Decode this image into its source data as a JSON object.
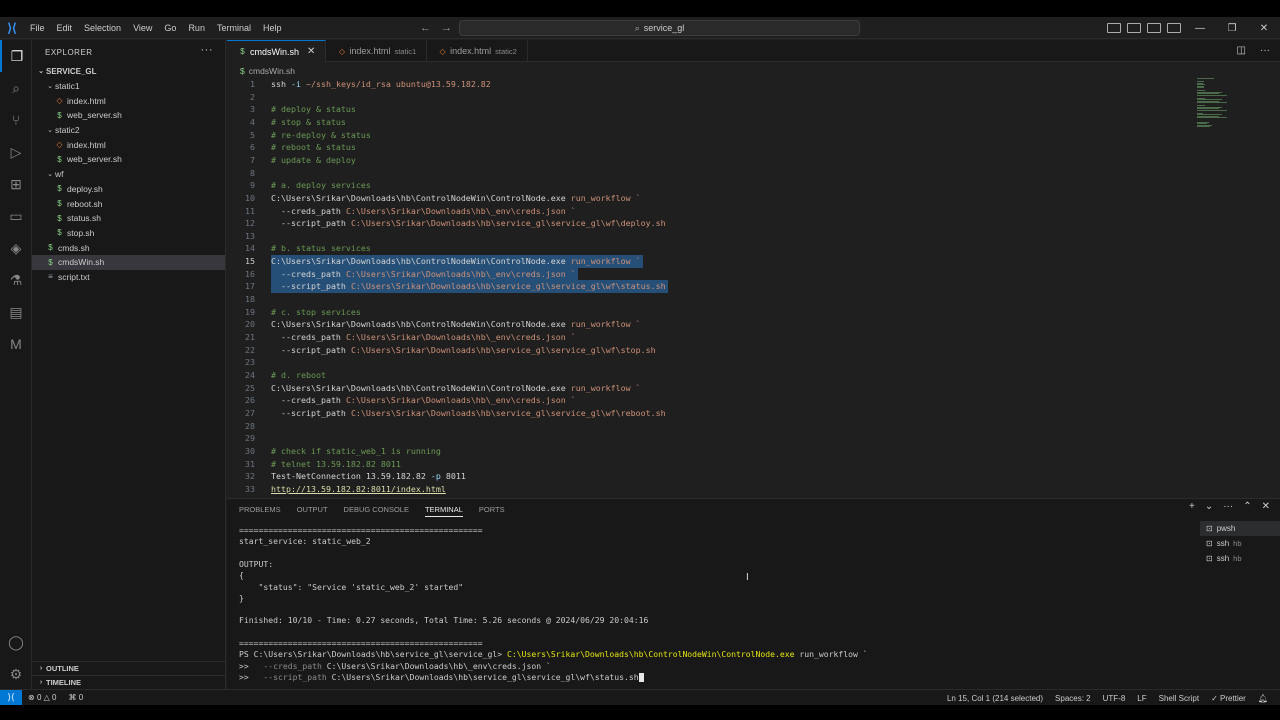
{
  "menu": [
    "File",
    "Edit",
    "Selection",
    "View",
    "Go",
    "Run",
    "Terminal",
    "Help"
  ],
  "command_center": "service_gl",
  "explorer": {
    "header": "EXPLORER",
    "root": "SERVICE_GL",
    "items": [
      {
        "label": "static1",
        "type": "folder",
        "depth": 1
      },
      {
        "label": "index.html",
        "type": "html",
        "depth": 2
      },
      {
        "label": "web_server.sh",
        "type": "sh",
        "depth": 2
      },
      {
        "label": "static2",
        "type": "folder",
        "depth": 1
      },
      {
        "label": "index.html",
        "type": "html",
        "depth": 2
      },
      {
        "label": "web_server.sh",
        "type": "sh",
        "depth": 2
      },
      {
        "label": "wf",
        "type": "folder",
        "depth": 1
      },
      {
        "label": "deploy.sh",
        "type": "sh",
        "depth": 2
      },
      {
        "label": "reboot.sh",
        "type": "sh",
        "depth": 2
      },
      {
        "label": "status.sh",
        "type": "sh",
        "depth": 2
      },
      {
        "label": "stop.sh",
        "type": "sh",
        "depth": 2
      },
      {
        "label": "cmds.sh",
        "type": "sh",
        "depth": 1
      },
      {
        "label": "cmdsWin.sh",
        "type": "sh",
        "depth": 1,
        "selected": true
      },
      {
        "label": "script.txt",
        "type": "txt",
        "depth": 1
      }
    ],
    "outline": "OUTLINE",
    "timeline": "TIMELINE"
  },
  "tabs": [
    {
      "label": "cmdsWin.sh",
      "sub": "",
      "active": true
    },
    {
      "label": "index.html",
      "sub": "static1",
      "active": false
    },
    {
      "label": "index.html",
      "sub": "static2",
      "active": false
    }
  ],
  "breadcrumb": "cmdsWin.sh",
  "code_lines": [
    {
      "n": "1",
      "segs": [
        [
          "",
          "ssh "
        ],
        [
          "flag",
          "-i"
        ],
        [
          "arg",
          " ~/ssh_keys/id_rsa ubuntu@13.59.182.82"
        ]
      ]
    },
    {
      "n": "2",
      "segs": []
    },
    {
      "n": "3",
      "segs": [
        [
          "cmt",
          "# deploy & status"
        ]
      ]
    },
    {
      "n": "4",
      "segs": [
        [
          "cmt",
          "# stop & status"
        ]
      ]
    },
    {
      "n": "5",
      "segs": [
        [
          "cmt",
          "# re-deploy & status"
        ]
      ]
    },
    {
      "n": "6",
      "segs": [
        [
          "cmt",
          "# reboot & status"
        ]
      ]
    },
    {
      "n": "7",
      "segs": [
        [
          "cmt",
          "# update & deploy"
        ]
      ]
    },
    {
      "n": "8",
      "segs": []
    },
    {
      "n": "9",
      "segs": [
        [
          "cmt",
          "# a. deploy services"
        ]
      ]
    },
    {
      "n": "10",
      "segs": [
        [
          "",
          "C:\\Users\\Srikar\\Downloads\\hb\\ControlNodeWin\\ControlNode.exe "
        ],
        [
          "arg",
          "run_workflow `"
        ]
      ]
    },
    {
      "n": "11",
      "segs": [
        [
          "",
          "  --creds_path "
        ],
        [
          "arg",
          "C:\\Users\\Srikar\\Downloads\\hb\\_env\\creds.json `"
        ]
      ]
    },
    {
      "n": "12",
      "segs": [
        [
          "",
          "  --script_path "
        ],
        [
          "arg",
          "C:\\Users\\Srikar\\Downloads\\hb\\service_gl\\service_gl\\wf\\deploy.sh"
        ]
      ]
    },
    {
      "n": "13",
      "segs": []
    },
    {
      "n": "14",
      "segs": [
        [
          "cmt",
          "# b. status services"
        ]
      ]
    },
    {
      "n": "15",
      "segs": [
        [
          "",
          "C:\\Users\\Srikar\\Downloads\\hb\\ControlNodeWin\\ControlNode.exe "
        ],
        [
          "arg",
          "run_workflow `"
        ]
      ],
      "sel": true
    },
    {
      "n": "16",
      "segs": [
        [
          "",
          "  --creds_path "
        ],
        [
          "arg",
          "C:\\Users\\Srikar\\Downloads\\hb\\_env\\creds.json `"
        ]
      ],
      "sel": true
    },
    {
      "n": "17",
      "segs": [
        [
          "",
          "  --script_path "
        ],
        [
          "arg",
          "C:\\Users\\Srikar\\Downloads\\hb\\service_gl\\service_gl\\wf\\status.sh"
        ]
      ],
      "sel": true
    },
    {
      "n": "18",
      "segs": []
    },
    {
      "n": "19",
      "segs": [
        [
          "cmt",
          "# c. stop services"
        ]
      ]
    },
    {
      "n": "20",
      "segs": [
        [
          "",
          "C:\\Users\\Srikar\\Downloads\\hb\\ControlNodeWin\\ControlNode.exe "
        ],
        [
          "arg",
          "run_workflow `"
        ]
      ]
    },
    {
      "n": "21",
      "segs": [
        [
          "",
          "  --creds_path "
        ],
        [
          "arg",
          "C:\\Users\\Srikar\\Downloads\\hb\\_env\\creds.json `"
        ]
      ]
    },
    {
      "n": "22",
      "segs": [
        [
          "",
          "  --script_path "
        ],
        [
          "arg",
          "C:\\Users\\Srikar\\Downloads\\hb\\service_gl\\service_gl\\wf\\stop.sh"
        ]
      ]
    },
    {
      "n": "23",
      "segs": []
    },
    {
      "n": "24",
      "segs": [
        [
          "cmt",
          "# d. reboot"
        ]
      ]
    },
    {
      "n": "25",
      "segs": [
        [
          "",
          "C:\\Users\\Srikar\\Downloads\\hb\\ControlNodeWin\\ControlNode.exe "
        ],
        [
          "arg",
          "run_workflow `"
        ]
      ]
    },
    {
      "n": "26",
      "segs": [
        [
          "",
          "  --creds_path "
        ],
        [
          "arg",
          "C:\\Users\\Srikar\\Downloads\\hb\\_env\\creds.json `"
        ]
      ]
    },
    {
      "n": "27",
      "segs": [
        [
          "",
          "  --script_path "
        ],
        [
          "arg",
          "C:\\Users\\Srikar\\Downloads\\hb\\service_gl\\service_gl\\wf\\reboot.sh"
        ]
      ]
    },
    {
      "n": "28",
      "segs": []
    },
    {
      "n": "29",
      "segs": []
    },
    {
      "n": "30",
      "segs": [
        [
          "cmt",
          "# check if static_web_1 is running"
        ]
      ]
    },
    {
      "n": "31",
      "segs": [
        [
          "cmt",
          "# telnet 13.59.182.82 8011"
        ]
      ]
    },
    {
      "n": "32",
      "segs": [
        [
          "",
          "Test-NetConnection 13.59.182.82 "
        ],
        [
          "flag",
          "-p"
        ],
        [
          "",
          " 8011"
        ]
      ]
    },
    {
      "n": "33",
      "segs": [
        [
          "link",
          "http://13.59.182.82:8011/index.html"
        ]
      ]
    }
  ],
  "current_line": "15",
  "panel": {
    "tabs": [
      "PROBLEMS",
      "OUTPUT",
      "DEBUG CONSOLE",
      "TERMINAL",
      "PORTS"
    ],
    "active_tab": "TERMINAL",
    "terminal_lines": [
      {
        "text": "==================================================",
        "cls": ""
      },
      {
        "text": "start_service: static_web_2",
        "cls": ""
      },
      {
        "text": "",
        "cls": ""
      },
      {
        "text": "OUTPUT:",
        "cls": ""
      },
      {
        "text": "{",
        "cls": ""
      },
      {
        "text": "    \"status\": \"Service 'static_web_2' started\"",
        "cls": ""
      },
      {
        "text": "}",
        "cls": ""
      },
      {
        "text": "",
        "cls": ""
      },
      {
        "text": "Finished: 10/10 - Time: 0.27 seconds, Total Time: 5.26 seconds @ 2024/06/29 20:04:16",
        "cls": ""
      },
      {
        "text": "",
        "cls": ""
      },
      {
        "text": "==================================================",
        "cls": ""
      }
    ],
    "prompt": "PS C:\\Users\\Srikar\\Downloads\\hb\\service_gl\\service_gl> ",
    "prompt_cmd": "C:\\Users\\Srikar\\Downloads\\hb\\ControlNodeWin\\ControlNode.exe",
    "prompt_rest": " run_workflow `",
    "cont1_prefix": ">>   ",
    "cont1_flag": "--creds_path",
    "cont1_val": " C:\\Users\\Srikar\\Downloads\\hb\\_env\\creds.json `",
    "cont2_prefix": ">>   ",
    "cont2_flag": "--script_path",
    "cont2_val": " C:\\Users\\Srikar\\Downloads\\hb\\service_gl\\service_gl\\wf\\status.sh",
    "terminals": [
      {
        "label": "pwsh",
        "sub": ""
      },
      {
        "label": "ssh",
        "sub": "hb"
      },
      {
        "label": "ssh",
        "sub": "hb"
      }
    ]
  },
  "status": {
    "errors": "0",
    "warnings": "0",
    "ports": "0",
    "position": "Ln 15, Col 1 (214 selected)",
    "spaces": "Spaces: 2",
    "encoding": "UTF-8",
    "eol": "LF",
    "language": "Shell Script",
    "prettier": "Prettier"
  }
}
